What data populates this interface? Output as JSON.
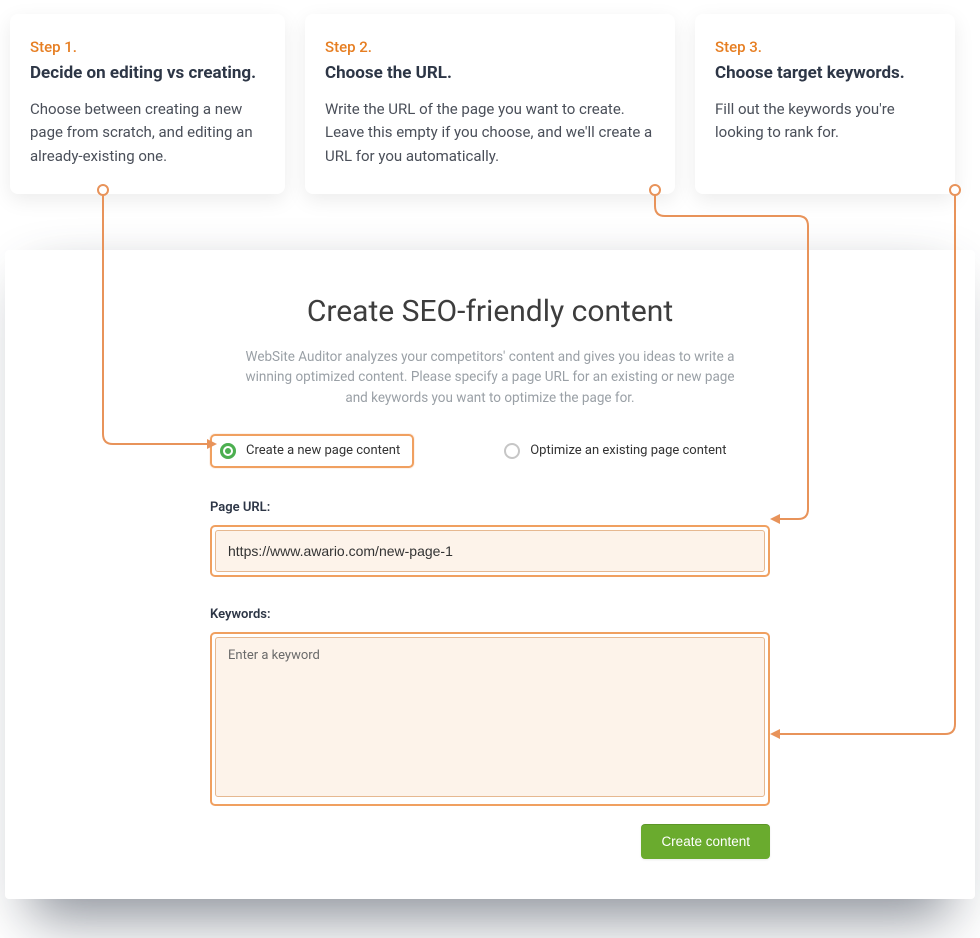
{
  "steps": [
    {
      "label": "Step 1.",
      "title": "Decide on editing vs creating.",
      "desc": "Choose between creating a new page from scratch, and editing an already-existing one."
    },
    {
      "label": "Step 2.",
      "title": "Choose the URL.",
      "desc": "Write the URL of the page you want to create. Leave this empty if you choose, and we'll create a URL for you automatically."
    },
    {
      "label": "Step 3.",
      "title": "Choose target keywords.",
      "desc": "Fill out the keywords you're looking to rank for."
    }
  ],
  "main": {
    "title": "Create SEO-friendly content",
    "desc": "WebSite Auditor analyzes your competitors' content and gives you ideas to write a winning optimized content. Please specify a page URL for an existing or new page and keywords you want to optimize the page for.",
    "radio_create": "Create a new page content",
    "radio_optimize": "Optimize an existing page content",
    "page_url_label": "Page URL:",
    "page_url_value": "https://www.awario.com/new-page-1",
    "keywords_label": "Keywords:",
    "keywords_placeholder": "Enter a keyword",
    "create_button": "Create content"
  }
}
